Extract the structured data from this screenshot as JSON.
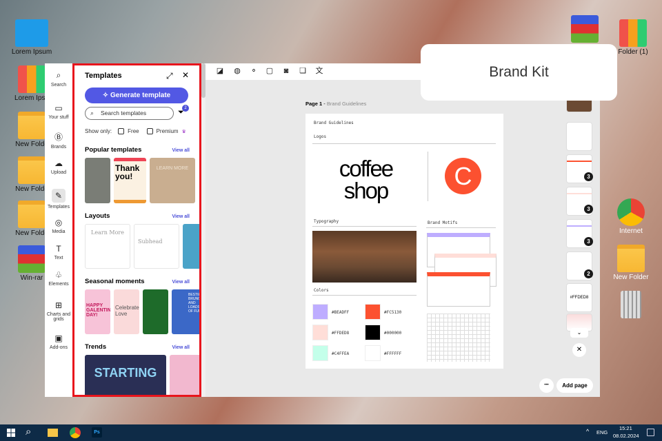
{
  "desktop": {
    "left_icons": [
      "Lorem Ipsum",
      "Lorem Ipsu",
      "New Folde",
      "New Folde",
      "New Folde",
      "Win-rar"
    ],
    "right_icons": [
      "Folder (1)",
      "Internet",
      "New Folder"
    ]
  },
  "brand_kit_label": "Brand Kit",
  "rail": [
    {
      "label": "Search",
      "icon": "search-icon"
    },
    {
      "label": "Your stuff",
      "icon": "folder-icon"
    },
    {
      "label": "Brands",
      "icon": "brand-icon"
    },
    {
      "label": "Upload",
      "icon": "upload-icon"
    },
    {
      "label": "Templates",
      "icon": "templates-icon"
    },
    {
      "label": "Media",
      "icon": "media-icon"
    },
    {
      "label": "Text",
      "icon": "text-icon"
    },
    {
      "label": "Elements",
      "icon": "elements-icon"
    },
    {
      "label": "Charts and grids",
      "icon": "chart-grid-icon"
    },
    {
      "label": "Add-ons",
      "icon": "addons-icon"
    }
  ],
  "panel": {
    "title": "Templates",
    "generate": "Generate template",
    "search_placeholder": "Search templates",
    "filter_count": "2",
    "show_only": "Show only:",
    "free": "Free",
    "premium": "Premium",
    "sections": [
      {
        "title": "Popular templates",
        "view_all": "View all"
      },
      {
        "title": "Layouts",
        "view_all": "View all"
      },
      {
        "title": "Seasonal moments",
        "view_all": "View all"
      },
      {
        "title": "Trends",
        "view_all": "View all"
      }
    ],
    "thumb_text": {
      "thank": "Thank you!",
      "learn": "LEARN MORE",
      "learn2": "Learn More",
      "subhead": "Subhead",
      "valentines": "HAPPY GALENTINES DAY!",
      "celebrate": "Celebrate Love",
      "brunch": "BESTIE BRUNCH, AND LOADS OF FUN",
      "starting": "STARTING"
    }
  },
  "canvas": {
    "page_label": "Page 1",
    "page_name": "Brand Guidelines",
    "doc": {
      "title": "Brand Guidelines",
      "logos": "Logos",
      "logo_text": [
        "coffee",
        "shop"
      ],
      "logo_letter": "C",
      "typography": "Typography",
      "colors": "Colors",
      "motifs": "Brand Motifs",
      "swatches": [
        {
          "hex": "#BEADFF",
          "color": "#BEADFF"
        },
        {
          "hex": "#FC5130",
          "color": "#FC5130"
        },
        {
          "hex": "#FFDED8",
          "color": "#FFDED8"
        },
        {
          "hex": "#000000",
          "color": "#000000"
        },
        {
          "hex": "#C4FFEA",
          "color": "#C4FFEA"
        },
        {
          "hex": "#FFFFFF",
          "color": "#FFFFFF"
        }
      ]
    },
    "thumb_badges": [
      "3",
      "3",
      "3",
      "2"
    ],
    "thumb_hex": "#FFDED8",
    "add_page": "Add page",
    "more": "•••"
  },
  "taskbar": {
    "lang": "ENG",
    "time": "15:21",
    "date": "08.02.2024"
  }
}
